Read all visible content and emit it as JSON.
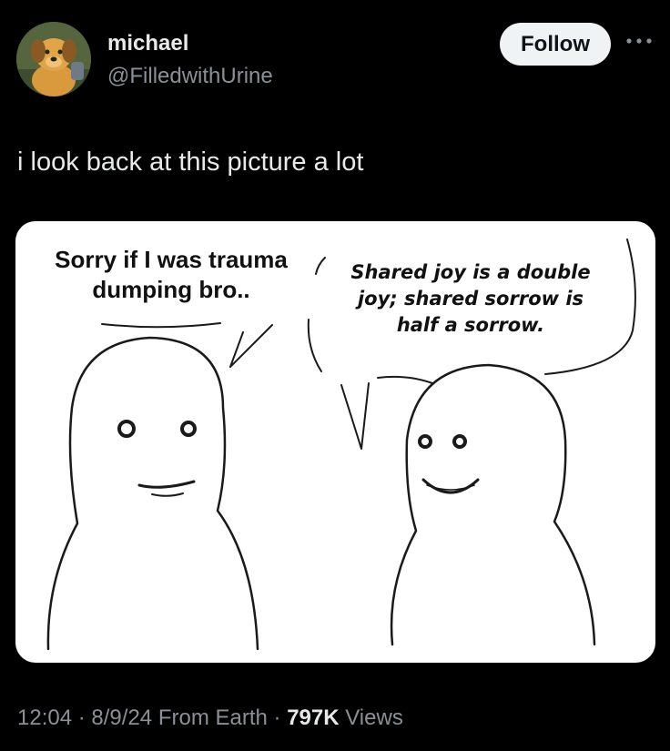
{
  "author": {
    "display_name": "michael",
    "handle": "@FilledwithUrine"
  },
  "actions": {
    "follow_label": "Follow",
    "more_icon": "more-horizontal-icon"
  },
  "tweet": {
    "text": "i look back at this picture a lot"
  },
  "image": {
    "left_bubble_line1": "Sorry if I was trauma",
    "left_bubble_line2": "dumping bro..",
    "right_bubble_line1": "Shared joy is a double",
    "right_bubble_line2": "joy; shared sorrow is",
    "right_bubble_line3": "half a sorrow."
  },
  "meta": {
    "time": "12:04",
    "separator": "·",
    "date": "8/9/24",
    "source": "From Earth",
    "views_count": "797K",
    "views_label": "Views"
  },
  "colors": {
    "background": "#000000",
    "primary_text": "#e7e9ea",
    "secondary_text": "#8b9097",
    "follow_button_bg": "#eff3f4"
  }
}
